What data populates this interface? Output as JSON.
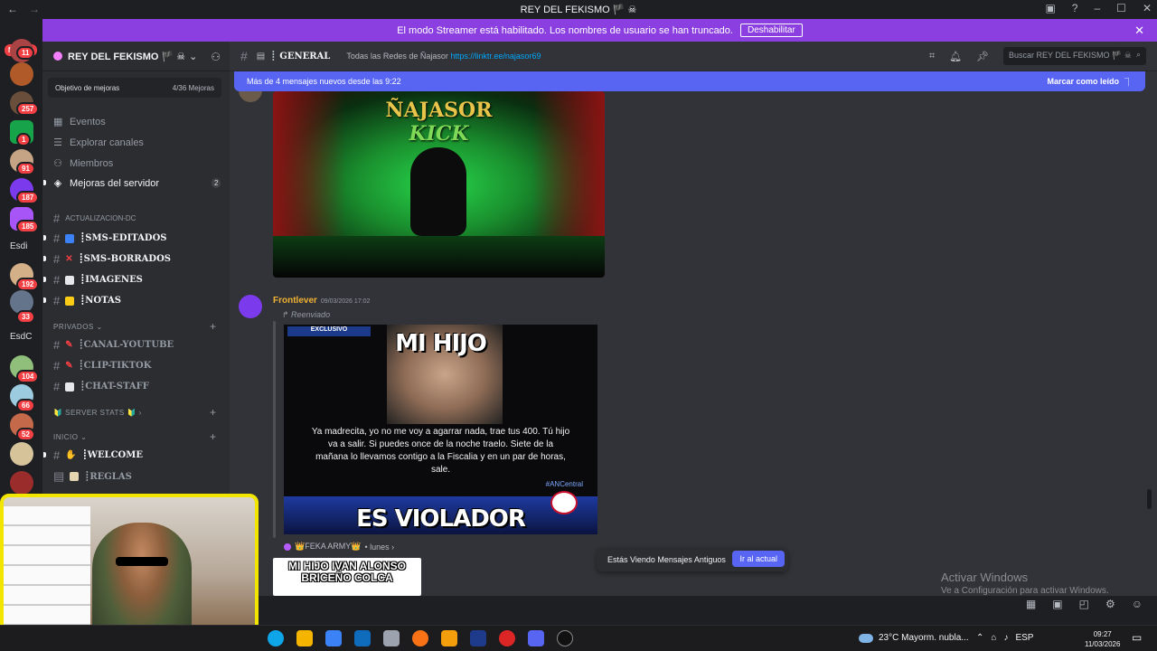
{
  "window": {
    "title": "REY DEL FEKISMO 🏴 ☠",
    "back_icon": "←",
    "fwd_icon": "→"
  },
  "banner": {
    "text": "El modo Streamer está habilitado. Los nombres de usuario se han truncado.",
    "button": "Deshabilitar"
  },
  "rail": {
    "nuevo": "NUEVO",
    "badges": [
      "11",
      "257",
      "1",
      "91",
      "187",
      "185",
      "192",
      "33",
      "104",
      "66",
      "52"
    ],
    "text_items": [
      "Esdi",
      "EsdC"
    ]
  },
  "sidebar": {
    "server_name": "REY DEL FEKISMO 🏴 ☠",
    "goal_label": "Objetivo de mejoras",
    "goal_value": "4/36 Mejoras",
    "nav": [
      {
        "label": "Eventos"
      },
      {
        "label": "Explorar canales"
      },
      {
        "label": "Miembros"
      },
      {
        "label": "Mejoras del servidor",
        "count": "2"
      }
    ],
    "channels_top": [
      {
        "name": "ACTUALIZACION-DC"
      },
      {
        "name": "┋SMS-EDITADOS"
      },
      {
        "name": "┋SMS-BORRADOS"
      },
      {
        "name": "┋IMAGENES"
      },
      {
        "name": "┋NOTAS"
      }
    ],
    "cat_privados": "PRIVADOS ⌄",
    "channels_priv": [
      {
        "name": "┋CANAL-YOUTUBE"
      },
      {
        "name": "┋CLIP-TIKTOK"
      },
      {
        "name": "┋CHAT-STAFF"
      }
    ],
    "cat_stats": "🔰 SERVER STATS 🔰 ›",
    "cat_inicio": "INICIO ⌄",
    "channels_inicio": [
      {
        "name": "┋WELCOME"
      },
      {
        "name": "┋REGLAS"
      }
    ]
  },
  "header": {
    "channel": "GENERAL",
    "topic_text": "Todas las Redes de Ñajasor",
    "topic_link": "https://linktr.ee/najasor69",
    "search_placeholder": "Buscar REY DEL FEKISMO 🏴 ☠"
  },
  "newbar": {
    "text": "Más de 4 mensajes nuevos desde las 9:22",
    "mark": "Marcar como leído"
  },
  "msg1": {
    "image_title": "ÑAJASOR",
    "image_subtitle": "KICK"
  },
  "msg2": {
    "author": "Frontlever",
    "timestamp": "09/03/2026 17:02",
    "forwarded": "↱ Reenviado",
    "meme_top": "MI HIJO",
    "meme_bottom": "ES VIOLADOR",
    "exclusivo": "EXCLUSIVO",
    "quote": "Ya madrecita, yo no me voy a agarrar nada, trae tus 400. Tú hijo va a salir. Si puedes once de la noche traelo. Siete de la mañana lo llevamos contigo a la Fiscalia y en un par de horas, sale.",
    "tag": "#ANCentral"
  },
  "reply": {
    "author": "👑FEKA ARMY👑",
    "when": "• lunes ›"
  },
  "msg3": {
    "caption": "MI HIJO IVAN ALONSO BRICEÑO COLCA"
  },
  "old_messages": {
    "text": "Estás Viendo Mensajes Antiguos",
    "button": "Ir al actual"
  },
  "windows_activation": {
    "title": "Activar Windows",
    "subtitle": "Ve a Configuración para activar Windows."
  },
  "taskbar": {
    "weather": "23°C  Mayorm. nubla...",
    "lang": "ESP",
    "time": "09:27",
    "date": "11/03/2026"
  }
}
